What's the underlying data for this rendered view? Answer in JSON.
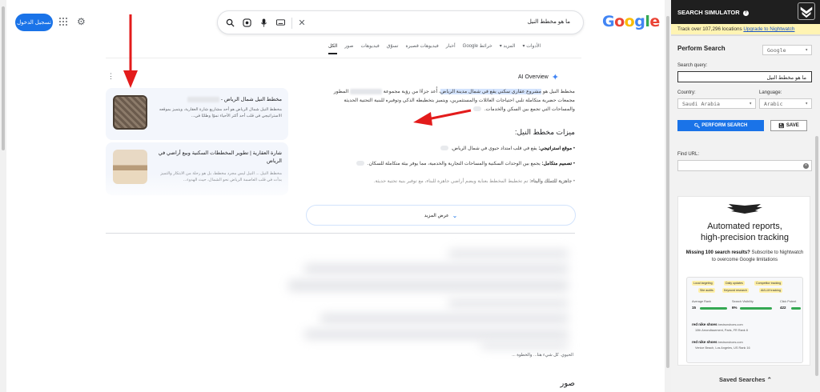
{
  "header": {
    "login_label": "تسجيل الدخول",
    "query": "ما هو مخطط النيل",
    "logo": "Google"
  },
  "tabs": [
    {
      "label": "الكل",
      "active": true
    },
    {
      "label": "صور"
    },
    {
      "label": "فيديوهات"
    },
    {
      "label": "تسوّق"
    },
    {
      "label": "فيديوهات قصيرة"
    },
    {
      "label": "أخبار"
    },
    {
      "label": "خرائط Google"
    },
    {
      "label": "المزيد ▾"
    },
    {
      "label": "الأدوات ▾"
    }
  ],
  "ai_overview": {
    "title": "AI Overview",
    "p1_a": "مخطط النيل هو",
    "p1_hl1": "مشروع عقاري سكني يقع في شمال مدينة الرياض",
    "p1_b": "، أُعد جزءًا من رؤية مجموعة",
    "p1_c": "المطور",
    "p2": "مجمعات حضرية متكاملة تلبي احتياجات العائلات والمستثمرين، ويتميز بتخطيطه الذكي وتوفيره للبنية التحتية الحديثة",
    "p3": "والمساحات التي تجمع بين السكن والخدمات.",
    "features_title": "ميزات مخطط النيل:",
    "features": [
      {
        "bold": "موقع استراتيجي:",
        "text": "يقع في قلب امتداد حيوي في شمال الرياض."
      },
      {
        "bold": "تصميم متكامل:",
        "text": "يجمع بين الوحدات السكنية والمساحات التجارية والخدمية، مما يوفر بيئة متكاملة للسكان."
      },
      {
        "bold": "جاهزية للتملك والبناء:",
        "text": "تم تخطيط المخطط بعناية ويضم أراضي جاهزة للبناء، مع توفير بنية تحتية حديثة."
      }
    ],
    "show_more": "عرض المزيد"
  },
  "sources": [
    {
      "title": "مخطط النيل شمال الرياض -",
      "snippet": "مخطط النيل شمال الرياض هو أحد مشاريع شارة العقارية، ويتميز بموقعه الاستراتيجي في قلب أحد أكثر الأحياء نموًا وطلبًا في..."
    },
    {
      "title": "شارة العقارية | تطوير المخططات السكنية وبيع أراضي في الرياض",
      "snippet": "مخطط النيل ... النيل ليس مجرد مخطط، بل هو رحلة من الابتكار والتميز بدأت في قلب العاصمة الرياض نحو الشمال، حيث الهدوء..."
    }
  ],
  "tail_text": "الحيوي. كل شيء هنا... والخطوة ...",
  "images_heading": "صور",
  "simulator": {
    "title": "SEARCH SIMULATOR",
    "help": "?",
    "banner_text": "Track over 107,296 locations",
    "banner_link": "Upgrade to Nightwatch",
    "perform_title": "Perform Search",
    "engine": "Google",
    "query_label": "Search query:",
    "query": "ما هو مخطط النيل",
    "country_label": "Country:",
    "country": "Saudi Arabia",
    "language_label": "Language:",
    "language": "Arabic",
    "perform_btn": "PERFORM SEARCH",
    "save_btn": "SAVE",
    "find_url_label": "Find URL:",
    "saved_searches": "Saved Searches ⌃"
  },
  "ad": {
    "headline1": "Automated reports,",
    "headline2": "high-precision tracking",
    "cta_bold": "Missing 100 search results?",
    "cta_text": "Subscribe to Nightwatch to overcome Google limitations",
    "pills": [
      "Local targeting",
      "Daily updates",
      "Competitor tracking",
      "Site audits",
      "Keyword research",
      "AI/LLM tracking"
    ],
    "stats": [
      {
        "label": "Average Rank",
        "value": "15"
      },
      {
        "label": "Search Visibility",
        "value": "6%"
      },
      {
        "label": "Click Potent",
        "value": "422"
      }
    ],
    "rows": [
      {
        "kw": "red nike shoes",
        "site": "bestrunshoes.com",
        "loc": "10th Arrondissement, Paris, FR",
        "rank": "Rank 8"
      },
      {
        "kw": "red nike shoes",
        "site": "bestrunshoes.com",
        "loc": "Venice Beach, Los Angeles, US",
        "rank": "Rank 16"
      }
    ]
  }
}
